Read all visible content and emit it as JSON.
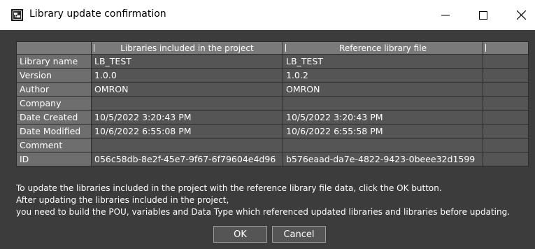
{
  "window": {
    "title": "Library update confirmation",
    "controls": {
      "minimize": "—",
      "maximize": "☐",
      "close": "✕"
    }
  },
  "table": {
    "columns": [
      "",
      "Libraries included in the project",
      "Reference library file",
      ""
    ],
    "rows": [
      {
        "label": "Library name",
        "project": "LB_TEST",
        "reference": "LB_TEST"
      },
      {
        "label": "Version",
        "project": "1.0.0",
        "reference": "1.0.2"
      },
      {
        "label": "Author",
        "project": "OMRON",
        "reference": "OMRON"
      },
      {
        "label": "Company",
        "project": "",
        "reference": ""
      },
      {
        "label": "Date Created",
        "project": "10/5/2022 3:20:43 PM",
        "reference": "10/5/2022 3:20:43 PM"
      },
      {
        "label": "Date Modified",
        "project": "10/6/2022 6:55:08 PM",
        "reference": "10/6/2022 6:55:58 PM"
      },
      {
        "label": "Comment",
        "project": "",
        "reference": ""
      },
      {
        "label": "ID",
        "project": "056c58db-8e2f-45e7-9f67-6f79604e4d96",
        "reference": "b576eaad-da7e-4822-9423-0beee32d1599"
      }
    ]
  },
  "message": {
    "line1": "To update the libraries included in the project with the reference library file data, click the OK button.",
    "line2": "After updating the libraries included in the project,",
    "line3": "you need to build the POU, variables and Data Type which referenced updated libraries and libraries before updating."
  },
  "buttons": {
    "ok": "OK",
    "cancel": "Cancel"
  },
  "colors": {
    "background": "#3c3c3c",
    "header": "#7a7a7a",
    "cell": "#555555"
  }
}
